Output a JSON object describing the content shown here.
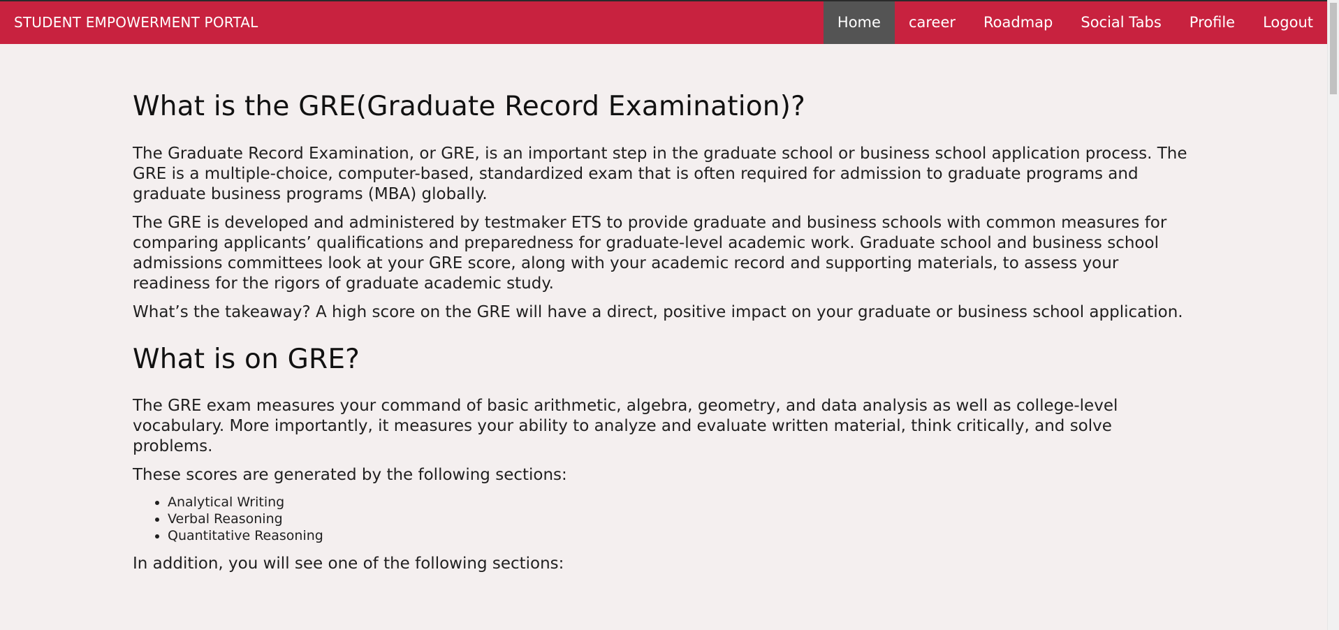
{
  "brand": "STUDENT EMPOWERMENT PORTAL",
  "nav": {
    "items": [
      "Home",
      "career",
      "Roadmap",
      "Social Tabs",
      "Profile",
      "Logout"
    ],
    "active": "Home"
  },
  "colors": {
    "header_bg": "#c8223f",
    "active_nav_bg": "#545454",
    "page_bg": "#f4efef"
  },
  "sections": {
    "gre_title": "What is the GRE(Graduate Record Examination)?",
    "gre_paragraphs": [
      "The Graduate Record Examination, or GRE, is an important step in the graduate school or business school application process. The GRE is a multiple-choice, computer-based, standardized exam that is often required for admission to graduate programs and graduate business programs (MBA) globally.",
      "The GRE is developed and administered by testmaker ETS to provide graduate and business schools with common measures for comparing applicants’ qualifications and preparedness for graduate-level academic work. Graduate school and business school admissions committees look at your GRE score, along with your academic record and supporting materials, to assess your readiness for the rigors of graduate academic study.",
      "What’s the takeaway? A high score on the GRE will have a direct, positive impact on your graduate or business school application."
    ],
    "on_gre_title": "What is on GRE?",
    "on_gre_paragraph": "The GRE exam measures your command of basic arithmetic, algebra, geometry, and data analysis as well as college-level vocabulary. More importantly, it measures your ability to analyze and evaluate written material, think critically, and solve problems.",
    "scores_intro": "These scores are generated by the following sections:",
    "score_sections": [
      "Analytical Writing",
      "Verbal Reasoning",
      "Quantitative Reasoning"
    ],
    "addition_text": "In addition, you will see one of the following sections:"
  }
}
